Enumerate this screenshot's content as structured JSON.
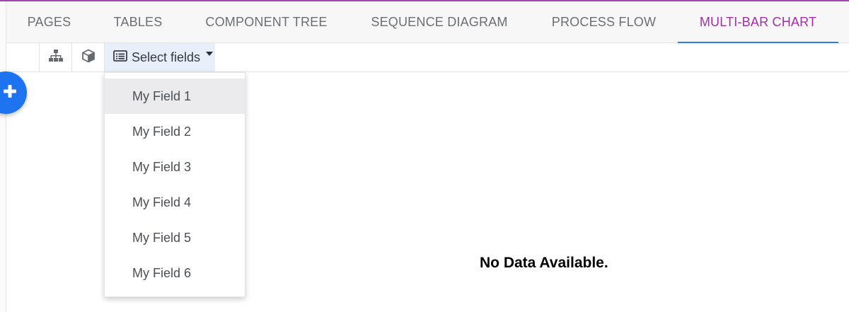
{
  "colors": {
    "accent_purple": "#a22fa8",
    "active_underline": "#2b7de9",
    "fab_blue": "#1e74f0",
    "select_bg": "#e8effa"
  },
  "tabs": [
    {
      "label": "PAGES",
      "active": false
    },
    {
      "label": "TABLES",
      "active": false
    },
    {
      "label": "COMPONENT TREE",
      "active": false
    },
    {
      "label": "SEQUENCE DIAGRAM",
      "active": false
    },
    {
      "label": "PROCESS FLOW",
      "active": false
    },
    {
      "label": "MULTI-BAR CHART",
      "active": true
    }
  ],
  "toolbar": {
    "hierarchy_icon": "sitemap-icon",
    "cube_icon": "cube-icon",
    "select_fields_icon": "list-card-icon",
    "select_fields_label": "Select fields",
    "select_fields_caret": "caret-down-icon"
  },
  "fab": {
    "icon": "plus-icon"
  },
  "dropdown": {
    "items": [
      {
        "label": "My Field 1",
        "highlighted": true
      },
      {
        "label": "My Field 2",
        "highlighted": false
      },
      {
        "label": "My Field 3",
        "highlighted": false
      },
      {
        "label": "My Field 4",
        "highlighted": false
      },
      {
        "label": "My Field 5",
        "highlighted": false
      },
      {
        "label": "My Field 6",
        "highlighted": false
      }
    ]
  },
  "chart_area": {
    "empty_message": "No Data Available."
  }
}
